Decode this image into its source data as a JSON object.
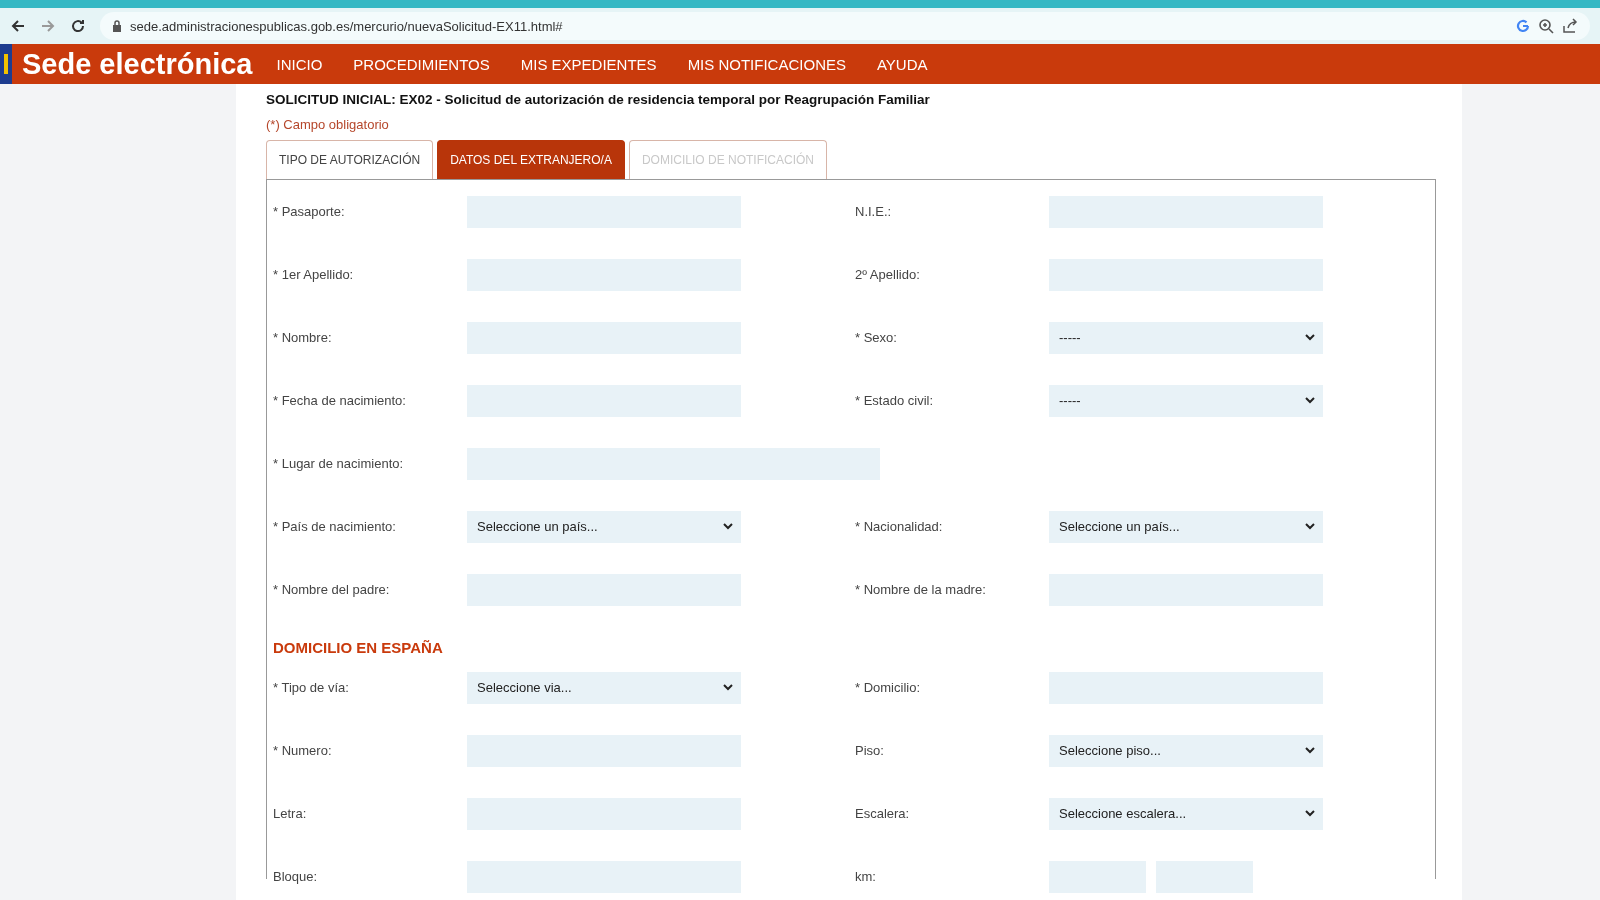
{
  "browser": {
    "url": "sede.administracionespublicas.gob.es/mercurio/nuevaSolicitud-EX11.html#"
  },
  "nav": {
    "brand": "Sede electrónica",
    "items": [
      "INICIO",
      "PROCEDIMIENTOS",
      "MIS EXPEDIENTES",
      "MIS NOTIFICACIONES",
      "AYUDA"
    ]
  },
  "title": "SOLICITUD INICIAL: EX02 - Solicitud de autorización de residencia temporal por Reagrupación Familiar",
  "required_note": "(*) Campo obligatorio",
  "tabs": [
    {
      "label": "TIPO DE AUTORIZACIÓN",
      "selected": false,
      "disabled": false
    },
    {
      "label": "DATOS DEL EXTRANJERO/A",
      "selected": true,
      "disabled": false
    },
    {
      "label": "DOMICILIO DE NOTIFICACIÓN",
      "selected": false,
      "disabled": true
    }
  ],
  "sections": [
    {
      "rows": [
        [
          {
            "label": "* Pasaporte:",
            "kind": "text"
          },
          {
            "label": "N.I.E.:",
            "kind": "text"
          }
        ],
        [
          {
            "label": "* 1er Apellido:",
            "kind": "text"
          },
          {
            "label": "2º Apellido:",
            "kind": "text"
          }
        ],
        [
          {
            "label": "* Nombre:",
            "kind": "text"
          },
          {
            "label": "* Sexo:",
            "kind": "select",
            "value": "-----"
          }
        ],
        [
          {
            "label": "* Fecha de nacimiento:",
            "kind": "text"
          },
          {
            "label": "* Estado civil:",
            "kind": "select",
            "value": "-----"
          }
        ],
        [
          {
            "label": "* Lugar de nacimiento:",
            "kind": "wide"
          }
        ],
        [
          {
            "label": "* País de nacimiento:",
            "kind": "select",
            "value": "Seleccione un país..."
          },
          {
            "label": "* Nacionalidad:",
            "kind": "select",
            "value": "Seleccione un país..."
          }
        ],
        [
          {
            "label": "* Nombre del padre:",
            "kind": "text"
          },
          {
            "label": "* Nombre de la madre:",
            "kind": "text"
          }
        ]
      ]
    },
    {
      "heading": "DOMICILIO EN ESPAÑA",
      "rows": [
        [
          {
            "label": "* Tipo de vía:",
            "kind": "select",
            "value": "Seleccione via..."
          },
          {
            "label": "* Domicilio:",
            "kind": "text"
          }
        ],
        [
          {
            "label": "* Numero:",
            "kind": "text"
          },
          {
            "label": "Piso:",
            "kind": "select",
            "value": "Seleccione piso..."
          }
        ],
        [
          {
            "label": "Letra:",
            "kind": "text"
          },
          {
            "label": "Escalera:",
            "kind": "select",
            "value": "Seleccione escalera..."
          }
        ],
        [
          {
            "label": "Bloque:",
            "kind": "text"
          },
          {
            "label": "km:",
            "kind": "split"
          }
        ]
      ]
    }
  ]
}
